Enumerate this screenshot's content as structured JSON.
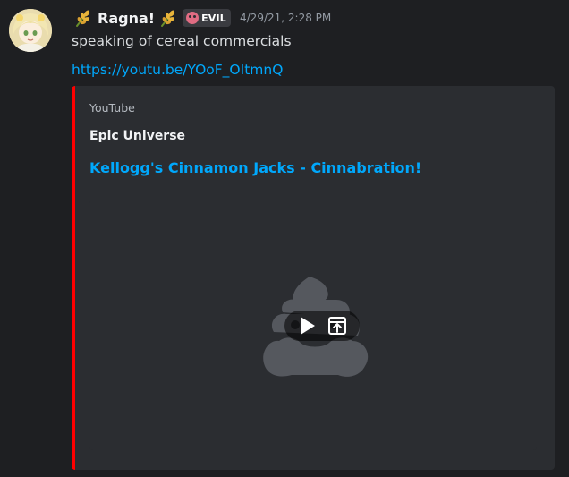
{
  "message": {
    "username": "Ragna!",
    "role_badge": "EVIL",
    "timestamp": "4/29/21, 2:28 PM",
    "text": "speaking of cereal commercials",
    "link": "https://youtu.be/YOoF_OItmnQ"
  },
  "embed": {
    "provider": "YouTube",
    "author": "Epic Universe",
    "title": "Kellogg's Cinnamon Jacks - Cinnabration!",
    "accent_color": "#ff0000",
    "video": {
      "play_icon": "play-icon",
      "open_icon": "open-external-icon"
    }
  },
  "colors": {
    "background": "#1e1f22",
    "embed_background": "#2b2d31",
    "link": "#00a8fc",
    "badge_icon": "#e06c83"
  },
  "icons": {
    "before_name": "wheat-icon",
    "after_name": "wheat-icon",
    "badge": "skull-icon",
    "placeholder": "poop-icon"
  }
}
